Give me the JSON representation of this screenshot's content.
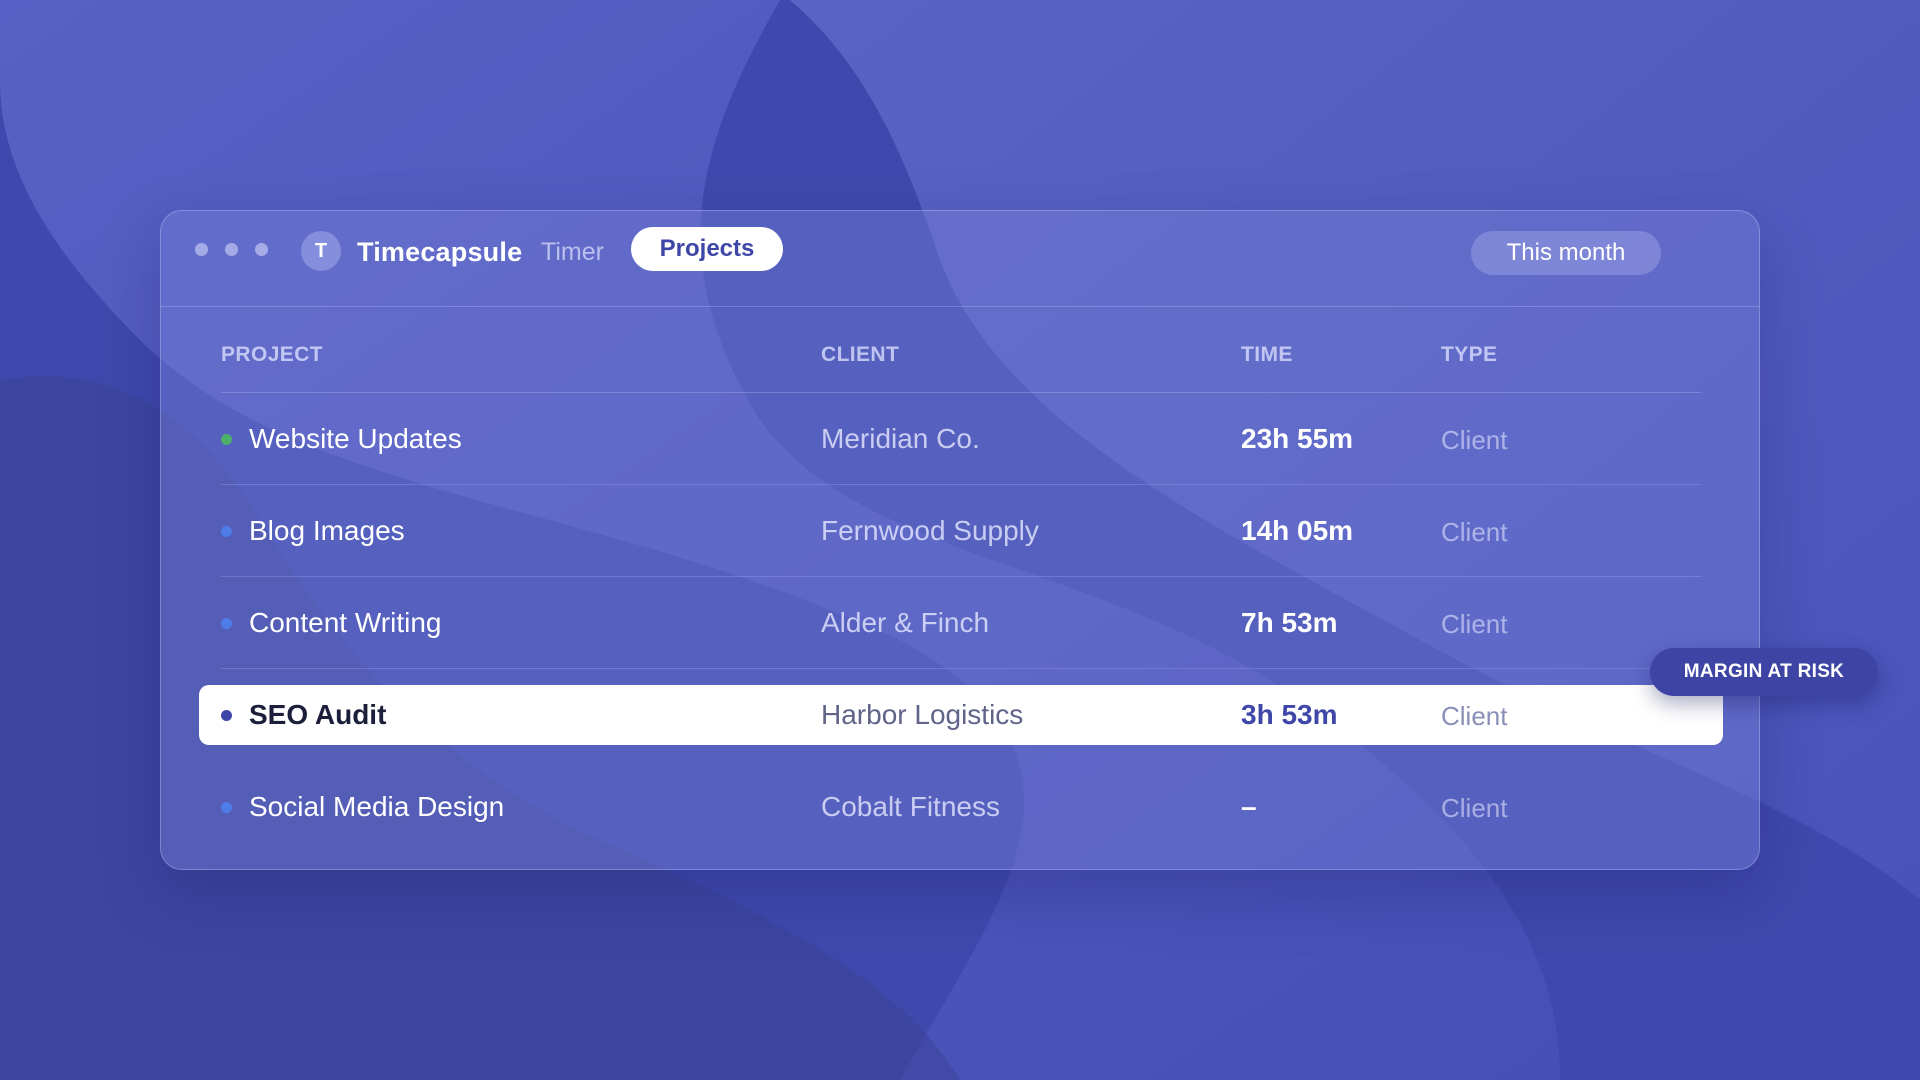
{
  "app": {
    "avatar_initial": "T",
    "name": "Timecapsule",
    "nav": {
      "timer": "Timer",
      "projects": "Projects"
    },
    "period": "This month"
  },
  "table": {
    "headers": {
      "project": "PROJECT",
      "client": "CLIENT",
      "time": "TIME",
      "type": "TYPE"
    },
    "rows": [
      {
        "project": "Website Updates",
        "client": "Meridian Co.",
        "time": "23h 55m",
        "type": "Client",
        "dot_color": "#4caf6a"
      },
      {
        "project": "Blog Images",
        "client": "Fernwood Supply",
        "time": "14h 05m",
        "type": "Client",
        "dot_color": "#4f7de8"
      },
      {
        "project": "Content Writing",
        "client": "Alder & Finch",
        "time": "7h 53m",
        "type": "Client",
        "dot_color": "#4f7de8"
      },
      {
        "project": "SEO Audit",
        "client": "Harbor Logistics",
        "time": "3h 53m",
        "type": "Client",
        "dot_color": "#3e47a8",
        "highlighted": true
      },
      {
        "project": "Social Media Design",
        "client": "Cobalt Fitness",
        "time": "–",
        "type": "Client",
        "dot_color": "#4f7de8"
      }
    ]
  },
  "badge": {
    "label": "MARGIN AT RISK"
  },
  "colors": {
    "background": "#3f49ad",
    "accent": "#3e47a8",
    "badge": "#3d44a3"
  }
}
